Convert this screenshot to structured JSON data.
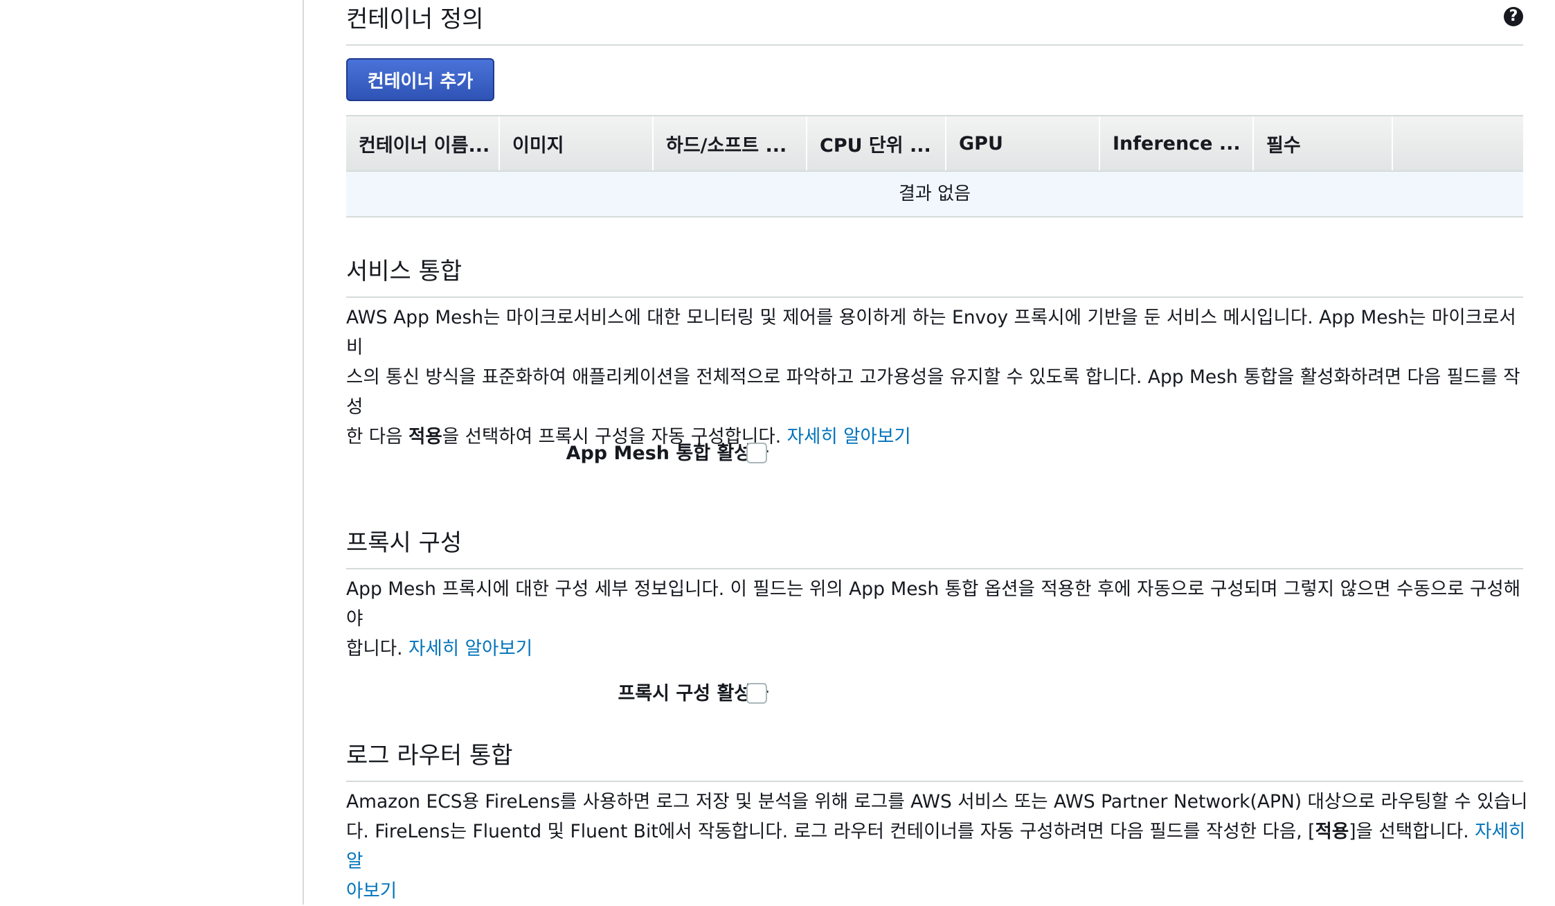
{
  "container_definitions": {
    "title": "컨테이너 정의",
    "add_button": "컨테이너 추가",
    "columns": [
      "컨테이너 이름...",
      "이미지",
      "하드/소프트 ...",
      "CPU 단위 ...",
      "GPU",
      "Inference ...",
      "필수",
      ""
    ],
    "empty_text": "결과 없음"
  },
  "service_integration": {
    "title": "서비스 통합",
    "desc_line1": "AWS App Mesh는 마이크로서비스에 대한 모니터링 및 제어를 용이하게 하는 Envoy 프록시에 기반을 둔 서비스 메시입니다. App Mesh는 마이크로서비",
    "desc_line2": "스의 통신 방식을 표준화하여 애플리케이션을 전체적으로 파악하고 고가용성을 유지할 수 있도록 합니다. App Mesh 통합을 활성화하려면 다음 필드를 작성",
    "desc_line3_pre": "한 다음 ",
    "desc_line3_bold": "적용",
    "desc_line3_post": "을 선택하여 프록시 구성을 자동 구성합니다. ",
    "learn_more": "자세히 알아보기",
    "checkbox_label": "App Mesh 통합 활성화",
    "checked": false
  },
  "proxy_config": {
    "title": "프록시 구성",
    "desc_line1": "App Mesh 프록시에 대한 구성 세부 정보입니다. 이 필드는 위의 App Mesh 통합 옵션을 적용한 후에 자동으로 구성되며 그렇지 않으면 수동으로 구성해야",
    "desc_line2_pre": "합니다. ",
    "learn_more": "자세히 알아보기",
    "checkbox_label": "프록시 구성 활성화",
    "checked": false
  },
  "log_router": {
    "title": "로그 라우터 통합",
    "desc_line1": "Amazon ECS용 FireLens를 사용하면 로그 저장 및 분석을 위해 로그를 AWS 서비스 또는 AWS Partner Network(APN) 대상으로 라우팅할 수 있습니",
    "desc_line2_pre": "다. FireLens는 Fluentd 및 Fluent Bit에서 작동합니다. 로그 라우터 컨테이너를 자동 구성하려면 다음 필드를 작성한 다음, [",
    "desc_line2_bold": "적용",
    "desc_line2_post": "]을 선택합니다. ",
    "learn_more_part1": "자세히 알",
    "learn_more_part2": "아보기"
  },
  "colors": {
    "link": "#0073bb",
    "primary_button": "#3a62c9",
    "divider": "#d5dbdb",
    "empty_row_bg": "#f1f7fd"
  },
  "icons": [
    "help-icon"
  ]
}
